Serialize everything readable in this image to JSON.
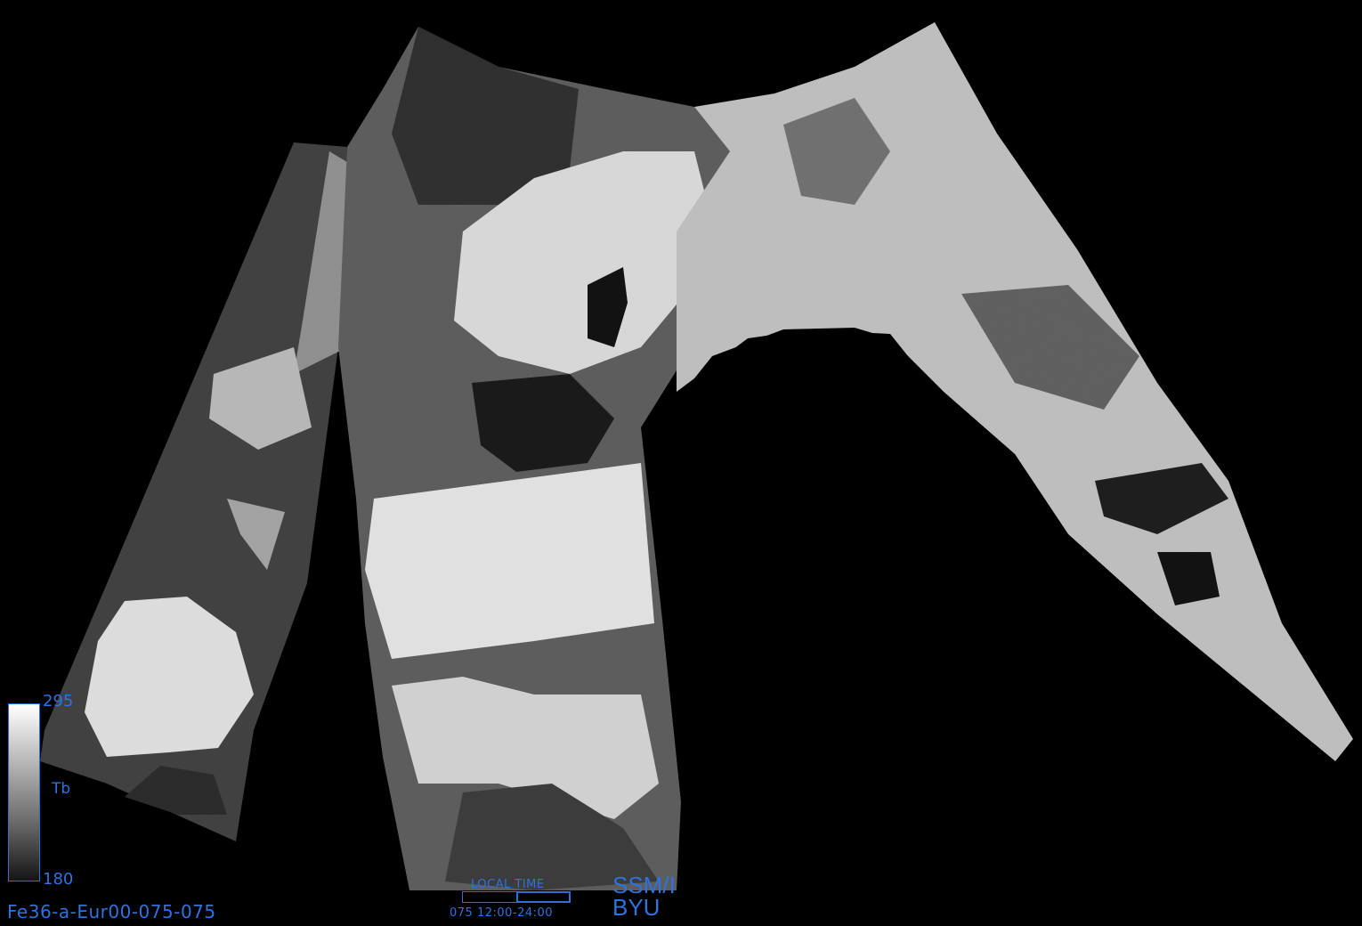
{
  "colorbar": {
    "max_label": "295",
    "min_label": "180",
    "variable_label": "Tb",
    "colors": [
      "#ffffff",
      "#151515"
    ]
  },
  "product_id": "Fe36-a-Eur00-075-075",
  "local_time": {
    "title": "LOCAL TIME",
    "range_text": "075  12:00-24:00",
    "day": "075",
    "fill_fraction": 0.5
  },
  "sensor": {
    "line1": "SSM/I",
    "line2": "BYU"
  },
  "colors": {
    "annotation": "#2f72dc",
    "background": "#000000"
  }
}
